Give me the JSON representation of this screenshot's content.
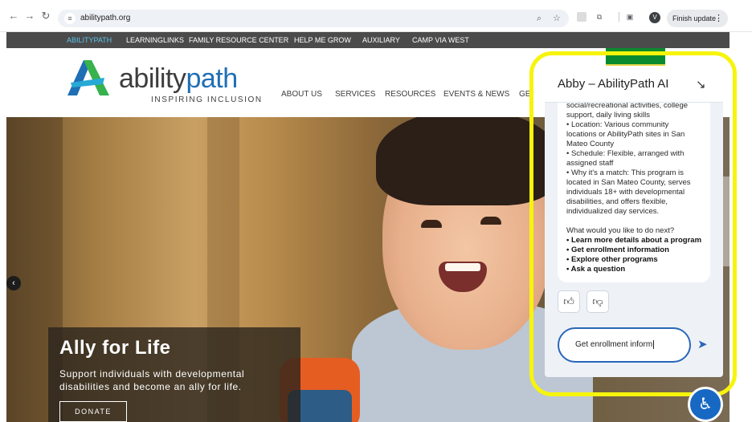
{
  "browser": {
    "url": "abilitypath.org",
    "profile_initial": "V",
    "finish_update": "Finish update"
  },
  "topbar": {
    "items": [
      "ABILITYPATH",
      "LEARNINGLINKS",
      "FAMILY RESOURCE CENTER",
      "HELP ME GROW",
      "AUXILIARY",
      "CAMP VIA WEST"
    ]
  },
  "header": {
    "brand_a": "ability",
    "brand_b": "path",
    "tagline": "INSPIRING INCLUSION",
    "nav": [
      "ABOUT US",
      "SERVICES",
      "RESOURCES",
      "EVENTS & NEWS",
      "GE"
    ]
  },
  "hero": {
    "title": "Ally for Life",
    "text": "Support individuals with developmental disabilities and become an ally for life.",
    "donate": "DONATE"
  },
  "social": [
    "f",
    "P",
    "in",
    "t"
  ],
  "chat": {
    "title": "Abby – AbilityPath AI",
    "lines": [
      "social/recreational activities, college",
      "support, daily living skills",
      "• Location: Various community",
      "locations or AbilityPath sites in San",
      "Mateo County",
      "• Schedule: Flexible, arranged with",
      "assigned staff",
      "• Why it's a match: This program is",
      "located in San Mateo County, serves",
      "individuals 18+ with developmental",
      "disabilities, and offers flexible,",
      "individualized day services.",
      "",
      "What would you like to do next?"
    ],
    "options": [
      "• Learn more details about a program",
      "• Get enrollment information",
      "• Explore other programs",
      "• Ask a question"
    ],
    "input_value": "Get enrollment inform"
  },
  "colors": {
    "highlight": "#f7f40c",
    "brand_blue": "#1f6fb5",
    "topbar": "#4b4b4b",
    "accent_green": "#0a8a2e"
  }
}
